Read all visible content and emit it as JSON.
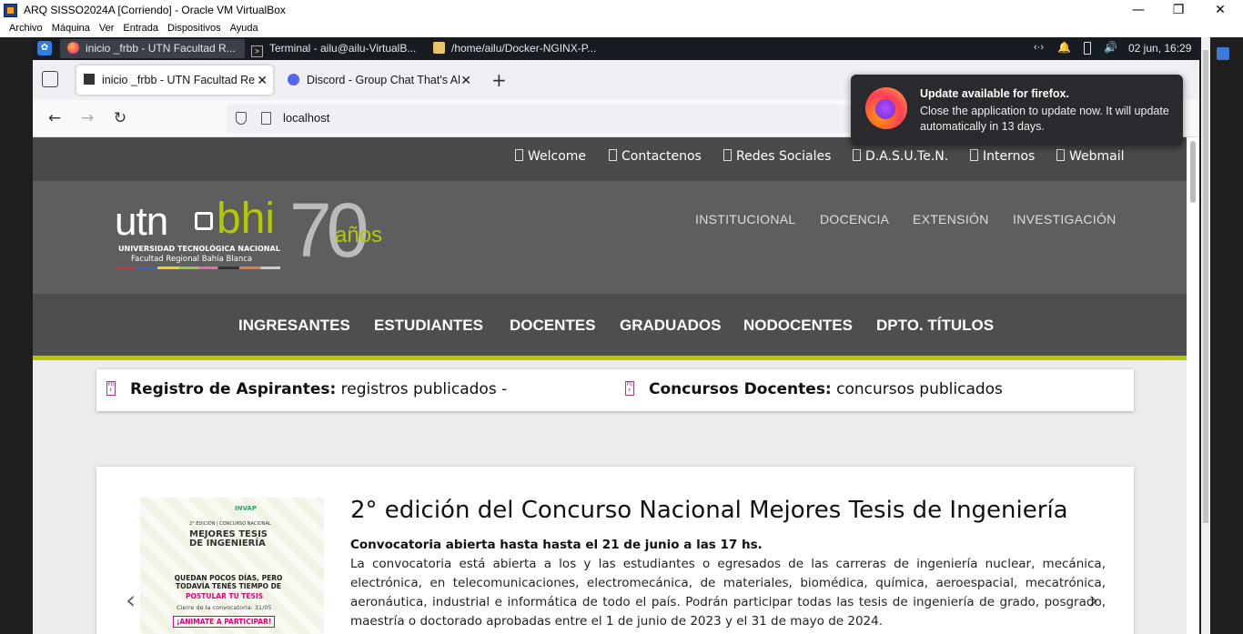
{
  "vbox": {
    "title": "ARQ SISSO2024A [Corriendo] - Oracle VM VirtualBox",
    "menu": [
      "Archivo",
      "Máquina",
      "Ver",
      "Entrada",
      "Dispositivos",
      "Ayuda"
    ],
    "window_controls": [
      "—",
      "❐",
      "✕"
    ]
  },
  "vm_panel": {
    "tasks": [
      {
        "label": "inicio _frbb - UTN Facultad R...",
        "icon": "firefox-icon"
      },
      {
        "label": "Terminal - ailu@ailu-VirtualB...",
        "icon": "terminal-icon"
      },
      {
        "label": "/home/ailu/Docker-NGINX-P...",
        "icon": "folder-icon"
      }
    ],
    "clock": "02 jun, 16:29"
  },
  "firefox": {
    "tabs": [
      {
        "label": "inicio _frbb - UTN Facultad Re",
        "selected": true
      },
      {
        "label": "Discord - Group Chat That's Al",
        "selected": false
      }
    ],
    "url": "localhost",
    "toast": {
      "title": "Update available for firefox.",
      "body": "Close the application to update now. It will update automatically in 13 days."
    }
  },
  "site": {
    "top_links": [
      "Welcome",
      "Contactenos",
      "Redes Sociales",
      "D.A.S.U.Te.N.",
      "Internos",
      "Webmail"
    ],
    "logo": {
      "utn": "utn",
      "bhi": "bhi",
      "seventy": "70",
      "anos": "años",
      "line1": "UNIVERSIDAD TECNOLÓGICA NACIONAL",
      "line2": "Facultad Regional Bahía Blanca"
    },
    "header_nav": [
      "INSTITUCIONAL",
      "DOCENCIA",
      "EXTENSIÓN",
      "INVESTIGACIÓN"
    ],
    "main_nav": [
      "INGRESANTES",
      "ESTUDIANTES",
      "DOCENTES",
      "GRADUADOS",
      "NODOCENTES",
      "DPTO. TÍTULOS"
    ],
    "notices": [
      {
        "bold": "Registro de Aspirantes:",
        "text": " registros publicados -"
      },
      {
        "bold": "Concursos Docentes:",
        "text": " concursos publicados"
      }
    ],
    "news": {
      "title": "2° edición del Concurso Nacional Mejores Tesis de Ingeniería",
      "subtitle": "Convocatoria abierta hasta hasta el 21 de junio a las 17 hs.",
      "body": "La convocatoria está abierta a los y las estudiantes o egresados de las carreras de ingeniería nuclear, mecánica, electrónica, en telecomunicaciones, electromecánica, de materiales, biomédica, química, aeroespacial, mecatrónica, aeronáutica, industrial e informática de todo el país. Podrán participar todas las tesis de ingeniería de grado, posgrado, maestría o doctorado aprobadas entre el 1 de junio de 2023 y el 31 de mayo de 2024.",
      "image_text": {
        "brand": "INVAP",
        "edition": "2° EDICIÓN | CONCURSO NACIONAL",
        "headline": "MEJORES TESIS DE INGENIERÍA",
        "line1": "QUEDAN POCOS DÍAS, PERO TODAVÍA TENÉS TIEMPO DE",
        "line2": "POSTULAR TU TESIS",
        "line3": "Cierre de la convocatoria: 31/05",
        "cta": "¡ANIMATE A PARTICIPAR!"
      }
    }
  }
}
